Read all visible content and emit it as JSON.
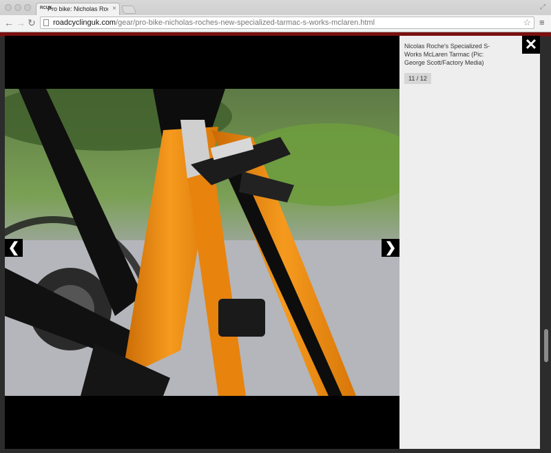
{
  "browser": {
    "tab_icon": "RCUK",
    "tab_title": "Pro bike: Nicholas Roche's",
    "tab_close": "×",
    "url_host": "roadcyclinguk.com",
    "url_path": "/gear/pro-bike-nicholas-roches-new-specialized-tarmac-s-works-mclaren.html",
    "icons": [
      "back-icon",
      "forward-icon",
      "reload-icon",
      "page-icon",
      "star-icon",
      "menu-icon",
      "fullscreen-icon"
    ]
  },
  "lightbox": {
    "caption": "Nicolas Roche's Specialized S-Works McLaren Tarmac (Pic: George Scott/Factory Media)",
    "counter": "11 / 12",
    "close_glyph": "✕",
    "prev_glyph": "❮",
    "next_glyph": "❯"
  },
  "colors": {
    "frame_orange": "#f08a12",
    "frame_black": "#0d0d0d",
    "overlay": "#000000",
    "panel": "#eeeeee"
  }
}
